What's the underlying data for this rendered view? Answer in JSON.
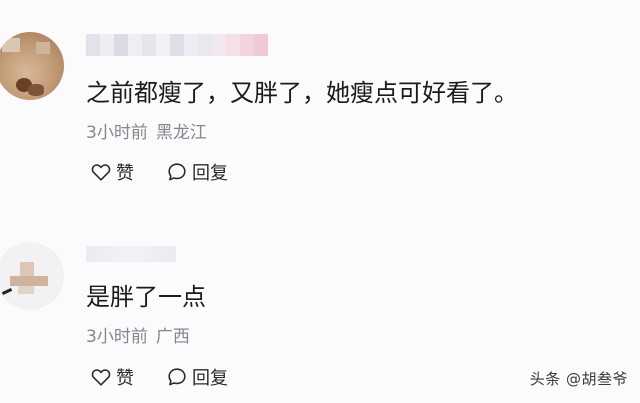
{
  "comments": [
    {
      "text": "之前都瘦了，又胖了，她瘦点可好看了。",
      "time": "3小时前",
      "location": "黑龙江",
      "like_label": "赞",
      "reply_label": "回复"
    },
    {
      "text": "是胖了一点",
      "time": "3小时前",
      "location": "广西",
      "like_label": "赞",
      "reply_label": "回复"
    }
  ],
  "watermark": "头条 @胡叁爷",
  "icons": {
    "like": "heart-outline-icon",
    "reply": "speech-bubble-icon"
  },
  "colors": {
    "text": "#1a1a1c",
    "meta": "#86868b",
    "background": "#fbfbfd"
  }
}
